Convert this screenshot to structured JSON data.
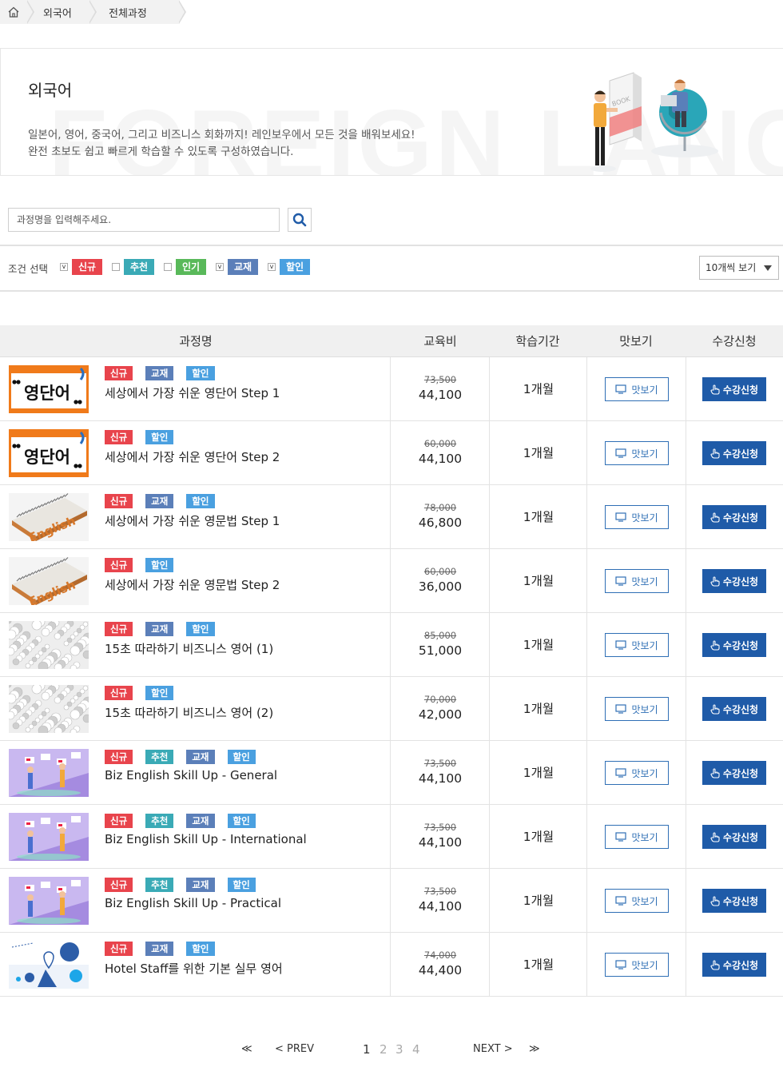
{
  "breadcrumb": {
    "items": [
      "외국어",
      "전체과정"
    ]
  },
  "banner": {
    "title": "외국어",
    "watermark": "FOREIGN LANGU",
    "desc_line1": "일본어, 영어, 중국어, 그리고 비즈니스 회화까지! 레인보우에서 모든 것을 배워보세요!",
    "desc_line2": "완전 초보도 쉽고 빠르게 학습할 수 있도록 구성하였습니다.",
    "illust_book_label": "BOOK"
  },
  "search": {
    "placeholder": "과정명을 입력해주세요."
  },
  "filter": {
    "label": "조건 선택",
    "options": [
      {
        "label": "신규",
        "checked": true,
        "color": "#e8444c"
      },
      {
        "label": "추천",
        "checked": false,
        "color": "#3aaab6"
      },
      {
        "label": "인기",
        "checked": false,
        "color": "#59b95a"
      },
      {
        "label": "교재",
        "checked": true,
        "color": "#5b7fb9"
      },
      {
        "label": "할인",
        "checked": true,
        "color": "#4aa0e0"
      }
    ],
    "per_page": "10개씩 보기"
  },
  "table": {
    "headers": [
      "과정명",
      "교육비",
      "학습기간",
      "맛보기",
      "수강신청"
    ],
    "preview_label": "맛보기",
    "enroll_label": "수강신청",
    "rows": [
      {
        "thumb": "voca-icon",
        "thumb_text": "영단어",
        "tags": [
          "신규",
          "교재",
          "할인"
        ],
        "title": "세상에서 가장 쉬운 영단어 Step 1",
        "orig": "73,500",
        "price": "44,100",
        "period": "1개월"
      },
      {
        "thumb": "voca-icon",
        "thumb_text": "영단어",
        "tags": [
          "신규",
          "할인"
        ],
        "title": "세상에서 가장 쉬운 영단어 Step 2",
        "orig": "60,000",
        "price": "44,100",
        "period": "1개월"
      },
      {
        "thumb": "english-book-icon",
        "thumb_text": "English",
        "tags": [
          "신규",
          "교재",
          "할인"
        ],
        "title": "세상에서 가장 쉬운 영문법 Step 1",
        "orig": "78,000",
        "price": "46,800",
        "period": "1개월"
      },
      {
        "thumb": "english-book-icon",
        "thumb_text": "English",
        "tags": [
          "신규",
          "할인"
        ],
        "title": "세상에서 가장 쉬운 영문법 Step 2",
        "orig": "60,000",
        "price": "36,000",
        "period": "1개월"
      },
      {
        "thumb": "letters-icon",
        "thumb_text": "",
        "tags": [
          "신규",
          "교재",
          "할인"
        ],
        "title": "15초 따라하기 비즈니스 영어 (1)",
        "orig": "85,000",
        "price": "51,000",
        "period": "1개월"
      },
      {
        "thumb": "letters-icon",
        "thumb_text": "",
        "tags": [
          "신규",
          "할인"
        ],
        "title": "15초 따라하기 비즈니스 영어 (2)",
        "orig": "70,000",
        "price": "42,000",
        "period": "1개월"
      },
      {
        "thumb": "flags-icon",
        "thumb_text": "",
        "tags": [
          "신규",
          "추천",
          "교재",
          "할인"
        ],
        "title": "Biz English Skill Up - General",
        "orig": "73,500",
        "price": "44,100",
        "period": "1개월"
      },
      {
        "thumb": "flags-icon",
        "thumb_text": "",
        "tags": [
          "신규",
          "추천",
          "교재",
          "할인"
        ],
        "title": "Biz English Skill Up - International",
        "orig": "73,500",
        "price": "44,100",
        "period": "1개월"
      },
      {
        "thumb": "flags-icon",
        "thumb_text": "",
        "tags": [
          "신규",
          "추천",
          "교재",
          "할인"
        ],
        "title": "Biz English Skill Up - Practical",
        "orig": "73,500",
        "price": "44,100",
        "period": "1개월"
      },
      {
        "thumb": "hotel-icon",
        "thumb_text": "",
        "tags": [
          "신규",
          "교재",
          "할인"
        ],
        "title": "Hotel Staff를 위한 기본 실무 영어",
        "orig": "74,000",
        "price": "44,400",
        "period": "1개월"
      }
    ]
  },
  "pagination": {
    "first": "≪",
    "prev": "< PREV",
    "pages": [
      "1",
      "2",
      "3",
      "4"
    ],
    "current": "1",
    "next": "NEXT >",
    "last": "≫"
  },
  "colors": {
    "tag_new": "#e8444c",
    "tag_recommend": "#3aaab6",
    "tag_popular": "#59b95a",
    "tag_book": "#5b7fb9",
    "tag_sale": "#4aa0e0",
    "enroll_button": "#1f5ba8"
  }
}
